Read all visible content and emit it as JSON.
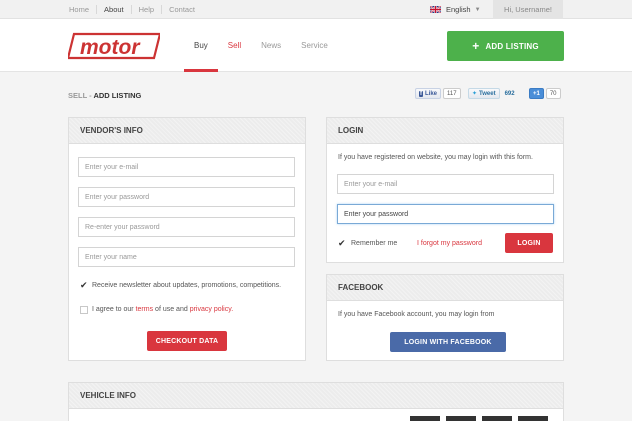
{
  "topbar": {
    "nav": [
      "Home",
      "About",
      "Help",
      "Contact"
    ],
    "language": "English",
    "user": "Hi, Username!"
  },
  "header": {
    "logo_text": "motor",
    "nav": [
      "Buy",
      "Sell",
      "News",
      "Service"
    ],
    "add_listing": "ADD LISTING"
  },
  "breadcrumb": {
    "parent": "SELL -",
    "current": "ADD LISTING"
  },
  "social": {
    "facebook_label": "Like",
    "facebook_count": "117",
    "twitter_label": "Tweet",
    "twitter_count": "692",
    "gplus_label": "+1",
    "gplus_count": "70"
  },
  "vendor": {
    "title": "VENDOR'S INFO",
    "email_placeholder": "Enter your e-mail",
    "password_placeholder": "Enter your password",
    "reenter_placeholder": "Re-enter your password",
    "name_placeholder": "Enter your name",
    "newsletter": "Receive newsletter about updates, promotions, competitions.",
    "agree_prefix": "I agree to our",
    "terms": "terms",
    "agree_middle": "of use and",
    "privacy": "privacy policy.",
    "checkout": "CHECKOUT DATA"
  },
  "login": {
    "title": "LOGIN",
    "intro": "If you have registered on website, you may login with this form.",
    "email_placeholder": "Enter your e-mail",
    "password_value": "Enter your password",
    "remember": "Remember me",
    "forgot": "I forgot my password",
    "button": "LOGIN"
  },
  "facebook": {
    "title": "FACEBOOK",
    "intro": "If you have Facebook account, you may login from",
    "button": "LOGIN WITH FACEBOOK"
  },
  "vehicle": {
    "title": "VEHICLE INFO"
  },
  "colors": {
    "accent_red": "#d9363e",
    "green": "#4db14b",
    "facebook_blue": "#4a6aa8"
  }
}
